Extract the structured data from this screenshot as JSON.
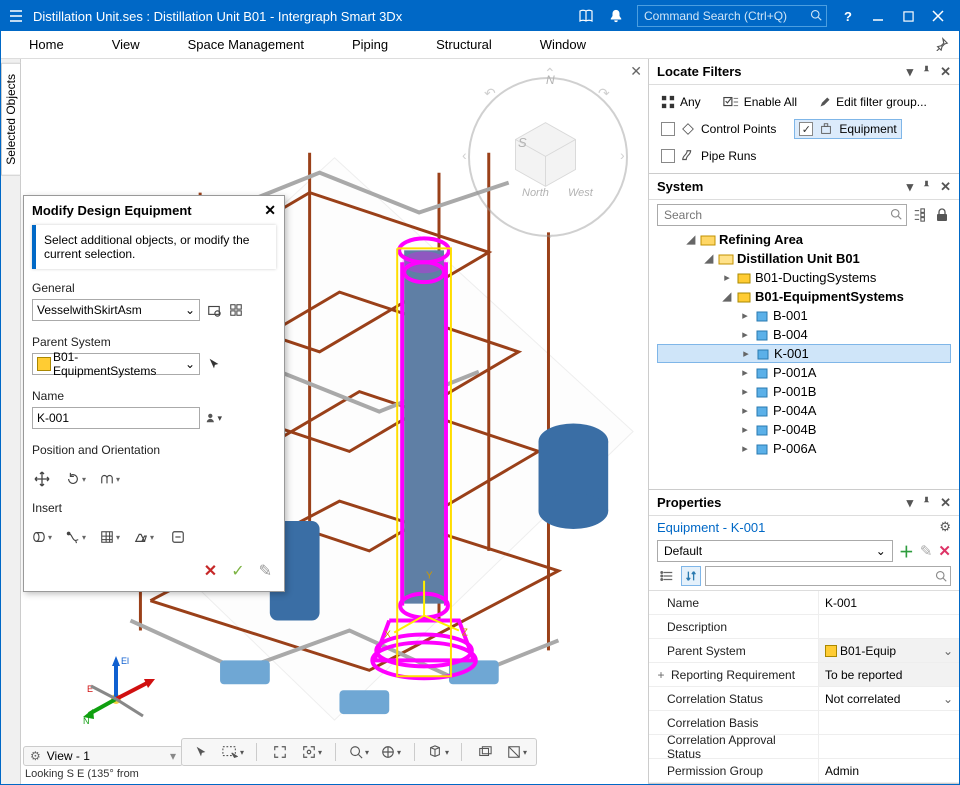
{
  "titlebar": {
    "title": "Distillation Unit.ses : Distillation Unit B01 - Intergraph Smart 3Dx",
    "search_placeholder": "Command Search (Ctrl+Q)"
  },
  "menu": {
    "home": "Home",
    "view": "View",
    "space": "Space Management",
    "piping": "Piping",
    "structural": "Structural",
    "window": "Window"
  },
  "left_tab": {
    "selected_objects": "Selected Objects"
  },
  "navcube": {
    "n": "N",
    "s": "S",
    "north": "North",
    "west": "West"
  },
  "modify": {
    "title": "Modify Design Equipment",
    "info": "Select additional objects, or modify the current selection.",
    "general_label": "General",
    "asm_value": "VesselwithSkirtAsm",
    "parent_label": "Parent System",
    "parent_value": "B01-EquipmentSystems",
    "name_label": "Name",
    "name_value": "K-001",
    "posori_label": "Position and Orientation",
    "insert_label": "Insert"
  },
  "view_status": {
    "label": "View - 1",
    "orient": "Looking S E (135° from"
  },
  "locate": {
    "title": "Locate Filters",
    "any": "Any",
    "enable_all": "Enable All",
    "edit_group": "Edit filter group...",
    "control_points": "Control Points",
    "equipment": "Equipment",
    "pipe_runs": "Pipe Runs"
  },
  "system": {
    "title": "System",
    "search_placeholder": "Search",
    "nodes": {
      "refining": "Refining Area",
      "distillation": "Distillation Unit B01",
      "ducting": "B01-DuctingSystems",
      "equipsys": "B01-EquipmentSystems",
      "b001": "B-001",
      "b004": "B-004",
      "k001": "K-001",
      "p001a": "P-001A",
      "p001b": "P-001B",
      "p004a": "P-004A",
      "p004b": "P-004B",
      "p006a": "P-006A"
    }
  },
  "properties": {
    "title": "Properties",
    "entity": "Equipment - K-001",
    "view_option": "Default",
    "rows": {
      "name_k": "Name",
      "name_v": "K-001",
      "desc_k": "Description",
      "desc_v": "",
      "parent_k": "Parent System",
      "parent_v": "B01-Equip",
      "report_k": "Reporting Requirement",
      "report_v": "To be reported",
      "corrstat_k": "Correlation Status",
      "corrstat_v": "Not correlated",
      "corrbasis_k": "Correlation Basis",
      "corrbasis_v": "",
      "corrappr_k": "Correlation Approval Status",
      "corrappr_v": "",
      "perm_k": "Permission Group",
      "perm_v": "Admin"
    }
  }
}
